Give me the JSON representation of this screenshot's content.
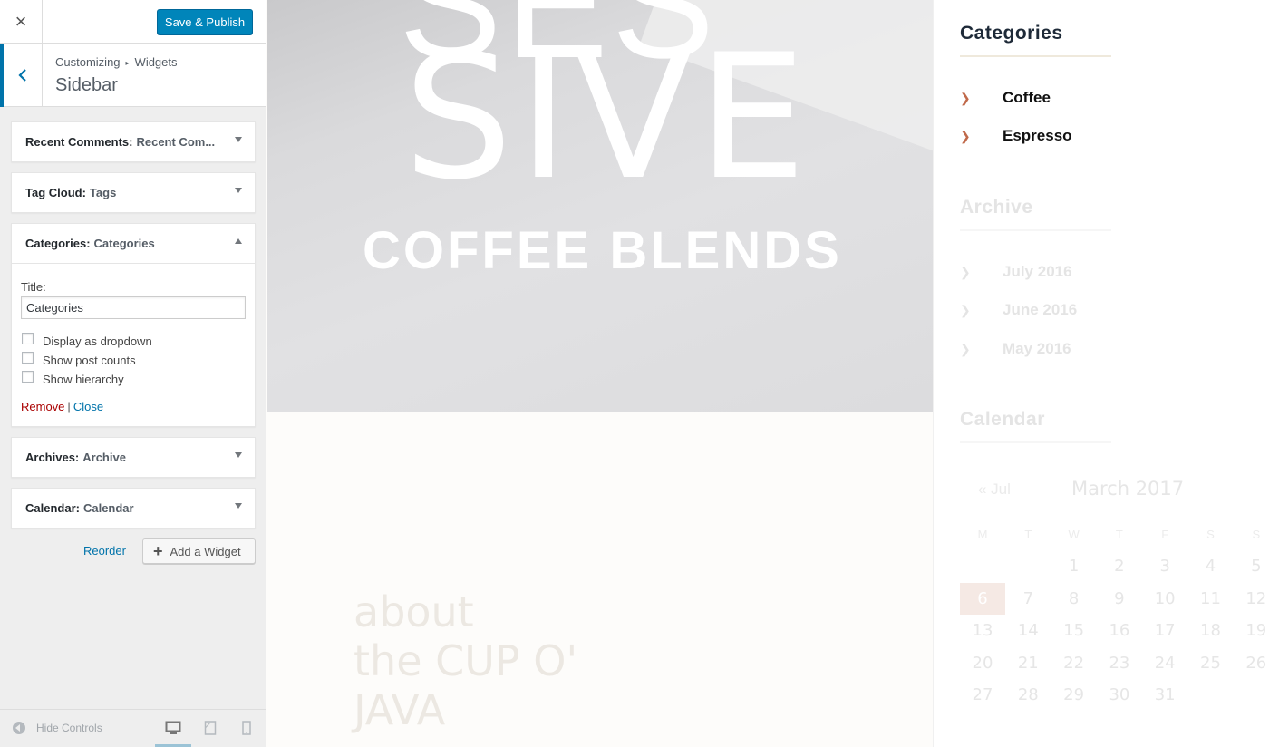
{
  "customizer": {
    "close_label": "×",
    "publish_label": "Save & Publish",
    "breadcrumb": [
      "Customizing",
      "Widgets"
    ],
    "breadcrumb_sep": "▸",
    "section_title": "Sidebar",
    "widgets": [
      {
        "type": "Recent Comments:",
        "title": "Recent Com...",
        "expanded": false
      },
      {
        "type": "Tag Cloud:",
        "title": "Tags",
        "expanded": false
      },
      {
        "type": "Categories:",
        "title": "Categories",
        "expanded": true
      },
      {
        "type": "Archives:",
        "title": "Archive",
        "expanded": false
      },
      {
        "type": "Calendar:",
        "title": "Calendar",
        "expanded": false
      }
    ],
    "form": {
      "title_label": "Title:",
      "title_value": "Categories",
      "checkboxes": [
        {
          "label": "Display as dropdown",
          "checked": false
        },
        {
          "label": "Show post counts",
          "checked": false
        },
        {
          "label": "Show hierarchy",
          "checked": false
        }
      ],
      "remove_label": "Remove",
      "pipe": "|",
      "close_label": "Close"
    },
    "reorder_label": "Reorder",
    "add_widget_label": "Add a Widget",
    "add_widget_plus": "+",
    "hide_controls_label": "Hide Controls",
    "devices": [
      "desktop-icon",
      "tablet-icon",
      "mobile-icon"
    ],
    "active_device": "desktop"
  },
  "preview": {
    "hero_clipped": "SES",
    "hero_big": "SIVE",
    "hero_sub": "COFFEE BLENDS",
    "about_lines": [
      "about",
      "the CUP O'",
      "JAVA"
    ],
    "categories_title": "Categories",
    "categories": [
      "Coffee",
      "Espresso"
    ],
    "archive_title": "Archive",
    "archives": [
      "July 2016",
      "June 2016",
      "May 2016"
    ],
    "calendar_title": "Calendar",
    "calendar": {
      "prev": "« Jul",
      "caption": "March 2017",
      "weekdays": [
        "M",
        "T",
        "W",
        "T",
        "F",
        "S",
        "S"
      ],
      "rows": [
        [
          "",
          "",
          "1",
          "2",
          "3",
          "4",
          "5"
        ],
        [
          "6",
          "7",
          "8",
          "9",
          "10",
          "11",
          "12"
        ],
        [
          "13",
          "14",
          "15",
          "16",
          "17",
          "18",
          "19"
        ],
        [
          "20",
          "21",
          "22",
          "23",
          "24",
          "25",
          "26"
        ],
        [
          "27",
          "28",
          "29",
          "30",
          "31",
          "",
          ""
        ]
      ],
      "today": "6"
    },
    "colors": {
      "accent": "#c0694a",
      "link": "#0073aa",
      "publish": "#0085ba"
    }
  }
}
